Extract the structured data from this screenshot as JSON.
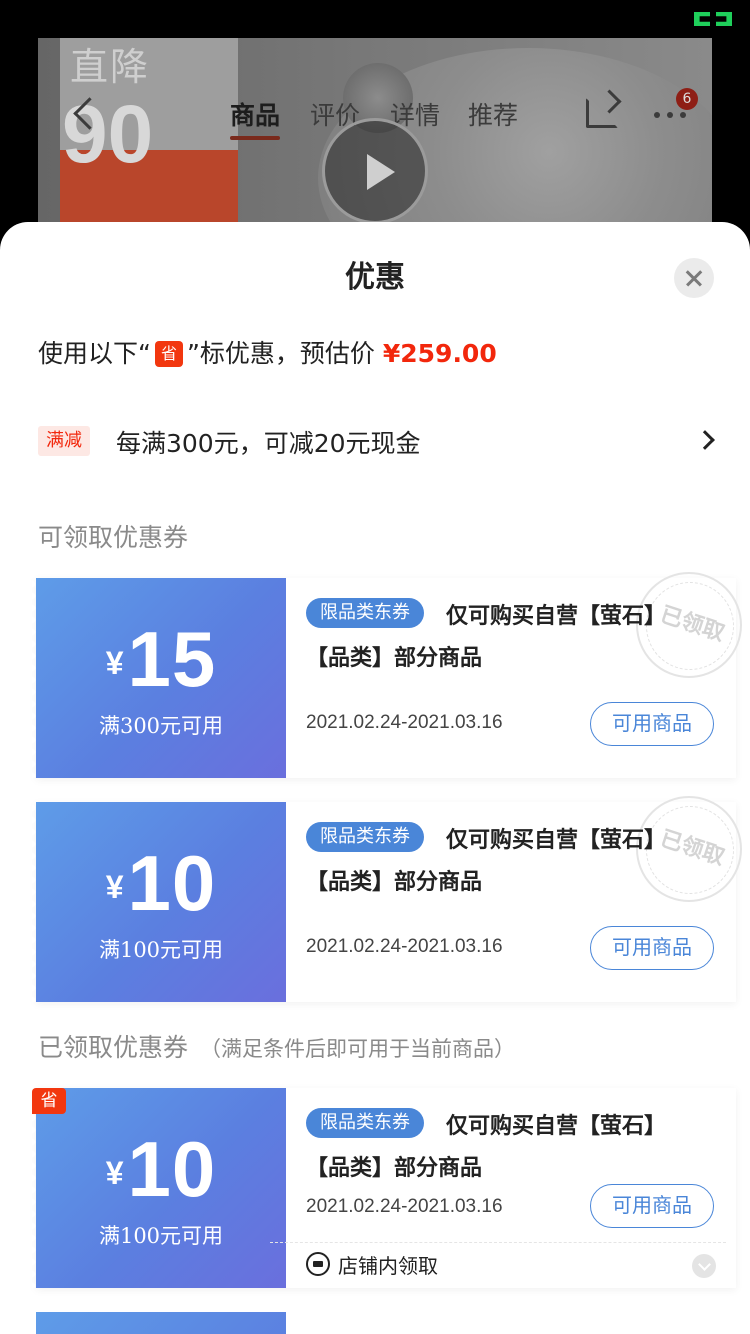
{
  "background": {
    "promo_line1": "直降",
    "promo_line2": "90",
    "tabs": [
      "商品",
      "评价",
      "详情",
      "推荐"
    ],
    "active_tab": "商品",
    "more_badge": "6"
  },
  "sheet": {
    "title": "优惠",
    "estimate": {
      "prefix": "使用以下“",
      "badge": "省",
      "suffix": "”标优惠，预估价",
      "price": "¥259.00"
    },
    "promotion": {
      "tag": "满减",
      "text": "每满300元，可减20元现金"
    },
    "available_section_title": "可领取优惠券",
    "claimed_section_title": "已领取优惠券",
    "claimed_section_note": "（满足条件后即可用于当前商品）",
    "coupons": [
      {
        "currency": "¥",
        "amount": "15",
        "condition": "满300元可用",
        "tag": "限品类东券",
        "desc_line1": "仅可购买自营【萤石】",
        "desc_line2": "【品类】部分商品",
        "date_range": "2021.02.24-2021.03.16",
        "button": "可用商品",
        "stamp": "已领取"
      },
      {
        "currency": "¥",
        "amount": "10",
        "condition": "满100元可用",
        "tag": "限品类东券",
        "desc_line1": "仅可购买自营【萤石】",
        "desc_line2": "【品类】部分商品",
        "date_range": "2021.02.24-2021.03.16",
        "button": "可用商品",
        "stamp": "已领取"
      },
      {
        "corner_badge": "省",
        "currency": "¥",
        "amount": "10",
        "condition": "满100元可用",
        "tag": "限品类东券",
        "desc_line1": "仅可购买自营【萤石】",
        "desc_line2": "【品类】部分商品",
        "date_range": "2021.02.24-2021.03.16",
        "button": "可用商品",
        "source": "店铺内领取"
      }
    ]
  },
  "colors": {
    "accent_red": "#f2270c",
    "coupon_blue": "#4a86d8"
  }
}
